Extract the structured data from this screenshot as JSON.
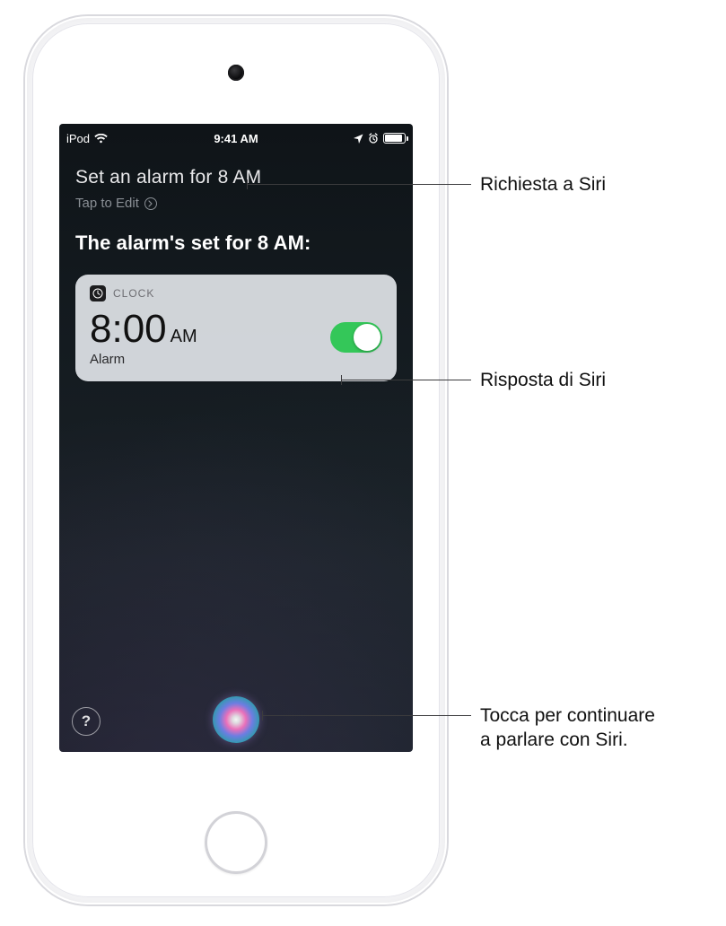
{
  "status_bar": {
    "carrier": "iPod",
    "time": "9:41 AM"
  },
  "siri": {
    "user_request": "Set an alarm for 8 AM",
    "tap_to_edit": "Tap to Edit",
    "response": "The alarm's set for 8 AM:"
  },
  "clock_card": {
    "app_name": "CLOCK",
    "time": "8:00",
    "ampm": "AM",
    "label": "Alarm",
    "toggle_on": true
  },
  "help_button": "?",
  "callouts": {
    "request": "Richiesta a Siri",
    "response": "Risposta di Siri",
    "orb": "Tocca per continuare\na parlare con Siri."
  }
}
